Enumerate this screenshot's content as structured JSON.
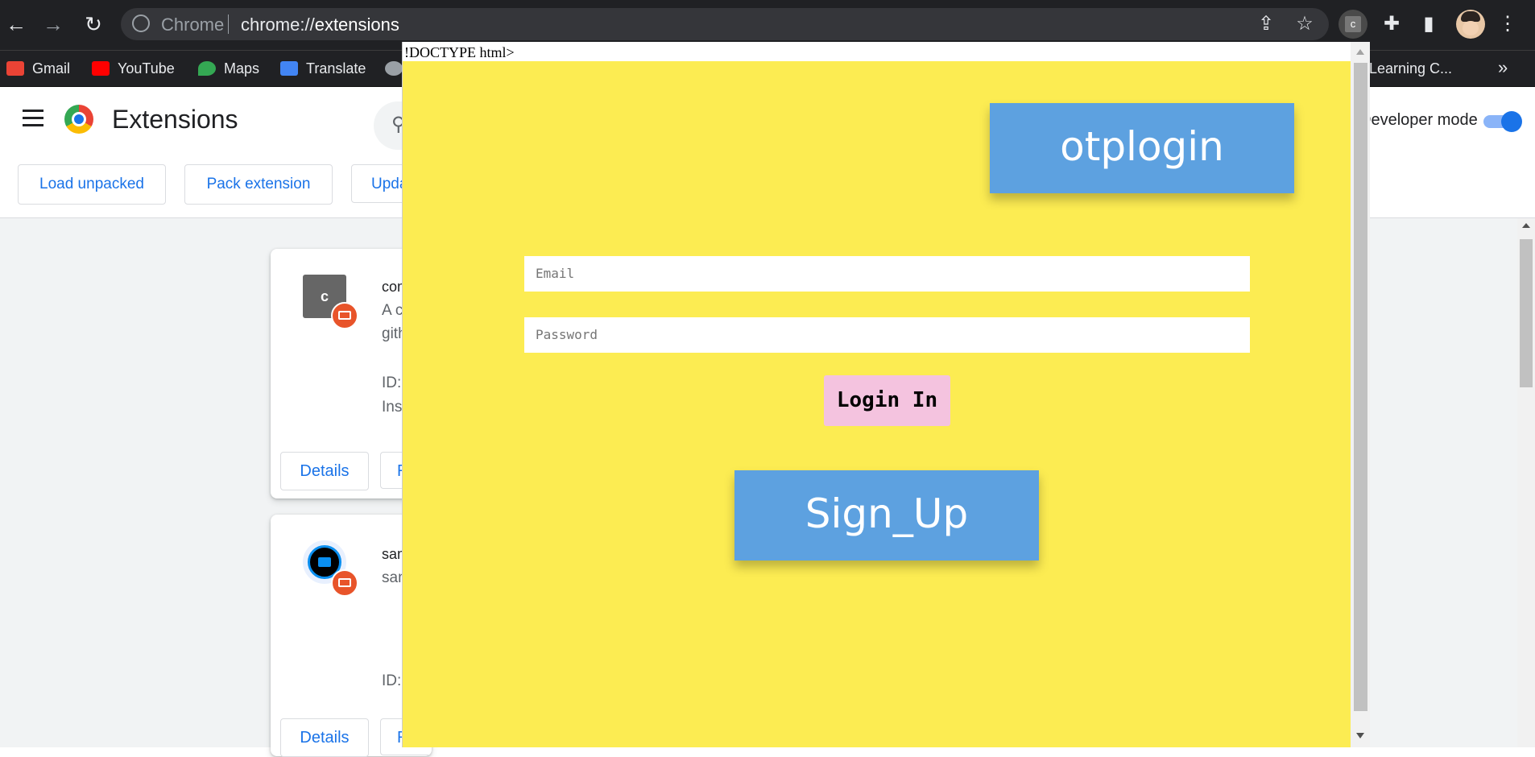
{
  "browser": {
    "omnibox": {
      "scheme_label": "Chrome",
      "url_prefix": "chrome://",
      "url_host": "extensions"
    },
    "extension_chip_letter": "c",
    "bookmarks": [
      {
        "label": "Gmail",
        "icon": "gmail-icon",
        "color": "#ea4335"
      },
      {
        "label": "YouTube",
        "icon": "youtube-icon",
        "color": "#ff0000"
      },
      {
        "label": "Maps",
        "icon": "maps-icon",
        "color": "#34a853"
      },
      {
        "label": "Translate",
        "icon": "translate-icon",
        "color": "#4285f4"
      }
    ],
    "bookmark_overflow_label": "Learning C...",
    "more_bookmarks": "»"
  },
  "extensions_page": {
    "title": "Extensions",
    "developer_mode_label": "Developer mode",
    "developer_mode_on": true,
    "buttons": {
      "load_unpacked": "Load unpacked",
      "pack_extension": "Pack extension",
      "update": "Update"
    },
    "cards": [
      {
        "icon_letter": "c",
        "name": "com",
        "desc_line1": "A c",
        "desc_line2": "gith",
        "id_label": "ID:",
        "installed_label": "Ins",
        "details": "Details",
        "second_btn": "R"
      },
      {
        "name": "sam",
        "desc_line1": "sam",
        "id_label": "ID:",
        "details": "Details",
        "second_btn": "R"
      }
    ]
  },
  "popup": {
    "doctype_text": "!DOCTYPE html>",
    "background_color": "#fcec52",
    "otplogin_label": "otplogin",
    "email_placeholder": "Email",
    "password_placeholder": "Password",
    "login_label": "Login In",
    "signup_label": "Sign_Up"
  }
}
